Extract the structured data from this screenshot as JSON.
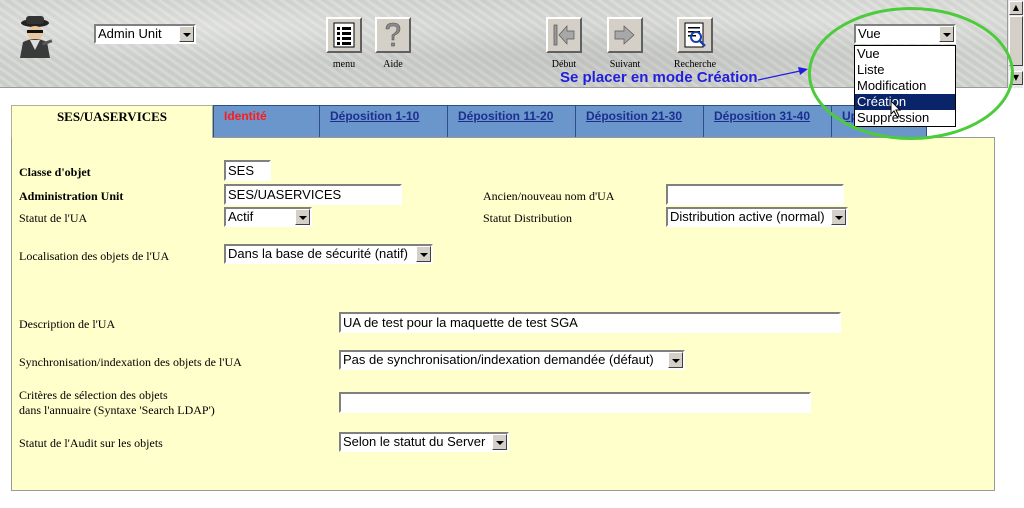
{
  "toolbar": {
    "unit_select": "Admin Unit",
    "buttons": [
      {
        "label": "menu"
      },
      {
        "label": "Aide"
      },
      {
        "label": "Début"
      },
      {
        "label": "Suivant"
      },
      {
        "label": "Recherche"
      }
    ],
    "mode_select": {
      "value": "Vue",
      "options": [
        "Vue",
        "Liste",
        "Modification",
        "Création",
        "Suppression"
      ],
      "highlighted": "Création"
    }
  },
  "annotation": {
    "text": "Se placer en mode Création",
    "circle_color": "#4ccb3b",
    "text_color": "#1f1fdc"
  },
  "tabs": [
    {
      "label": "SES/UASERVICES",
      "active": true
    },
    {
      "label": "Identité",
      "color": "#ff1a1a"
    },
    {
      "label": "Déposition 1-10"
    },
    {
      "label": "Déposition 11-20"
    },
    {
      "label": "Déposition 21-30"
    },
    {
      "label": "Déposition 31-40"
    },
    {
      "label": "Up"
    }
  ],
  "form": {
    "classe_objet": {
      "label": "Classe d'objet",
      "value": "SES"
    },
    "admin_unit": {
      "label": "Administration Unit",
      "value": "SES/UASERVICES"
    },
    "statut_ua": {
      "label": "Statut de l'UA",
      "value": "Actif"
    },
    "ancien_nom": {
      "label": "Ancien/nouveau nom d'UA",
      "value": ""
    },
    "statut_distribution": {
      "label": "Statut Distribution",
      "value": "Distribution active (normal)"
    },
    "localisation": {
      "label": "Localisation des objets de l'UA",
      "value": "Dans la base de sécurité (natif)"
    },
    "description": {
      "label": "Description de l'UA",
      "value": "UA de test pour la maquette de test SGA"
    },
    "synchronisation": {
      "label": "Synchronisation/indexation des objets de l'UA",
      "value": "Pas de synchronisation/indexation demandée (défaut)"
    },
    "criteres": {
      "label_line1": "Critères de sélection des objets",
      "label_line2": "dans l'annuaire (Syntaxe 'Search LDAP')",
      "value": ""
    },
    "statut_audit": {
      "label": "Statut de l'Audit sur les objets",
      "value": "Selon le statut du Server"
    }
  },
  "colors": {
    "panel_bg": "#ffffcc",
    "tab_bg": "#6b96cc",
    "selection_bg": "#0a246a"
  }
}
